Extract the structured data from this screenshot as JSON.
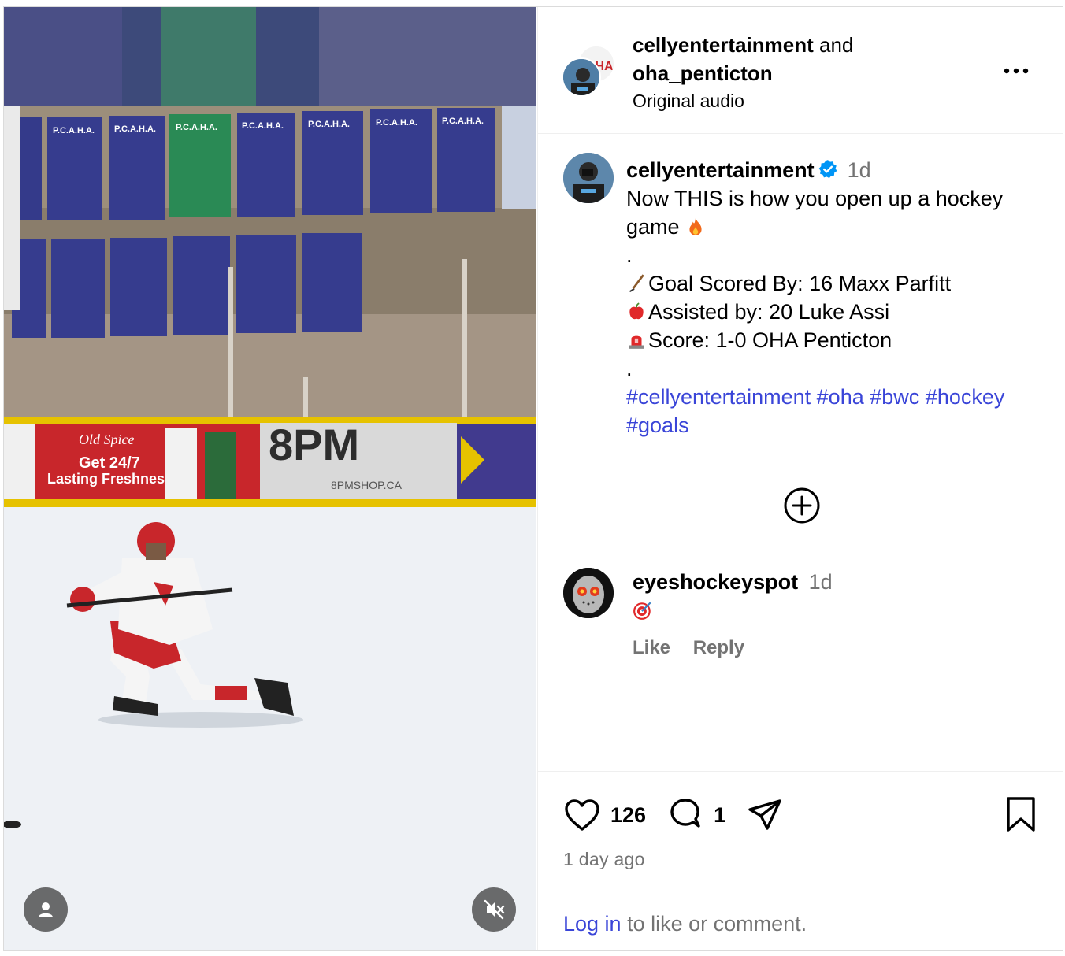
{
  "header": {
    "author_primary": "cellyentertainment",
    "joiner": "and",
    "author_secondary": "oha_penticton",
    "audio": "Original audio"
  },
  "caption": {
    "username": "cellyentertainment",
    "time": "1d",
    "line1": "Now THIS is how you open up a hockey game",
    "dot1": ".",
    "goal": "Goal Scored By: 16 Maxx Parfitt",
    "assist": "Assisted by: 20 Luke Assi",
    "score": "Score: 1-0 OHA Penticton",
    "dot2": ".",
    "hashtags": [
      "#cellyentertainment",
      "#oha",
      "#bwc",
      "#hockey",
      "#goals"
    ]
  },
  "comments": [
    {
      "username": "eyeshockeyspot",
      "time": "1d",
      "like_label": "Like",
      "reply_label": "Reply"
    }
  ],
  "footer": {
    "likes": "126",
    "comments": "1",
    "posted": "1 day ago",
    "login_link": "Log in",
    "login_rest": " to like or comment."
  },
  "media": {
    "ad_brand": "Old Spice",
    "ad_text_1": "Get 24/7",
    "ad_text_2": "Lasting Freshness",
    "sponsor_logo": "8PM",
    "sponsor_url": "8PMSHOP.CA",
    "banner_title": "P.C.A.H.A."
  },
  "colors": {
    "link": "#3a45d8",
    "muted": "#737373",
    "verified": "#0095f6"
  },
  "icons": [
    "more-icon",
    "verified-badge-icon",
    "plus-circle-icon",
    "heart-icon",
    "comment-icon",
    "share-icon",
    "bookmark-icon",
    "user-icon",
    "mute-icon"
  ]
}
